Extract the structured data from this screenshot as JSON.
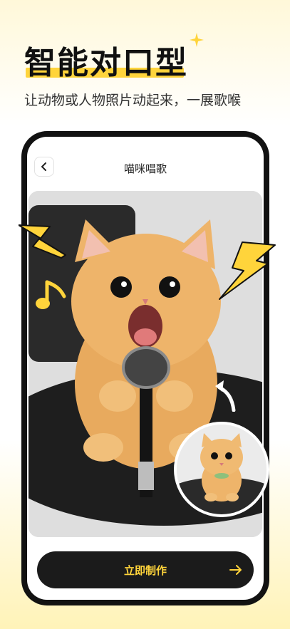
{
  "promo": {
    "headline": "智能对口型",
    "subtitle": "让动物或人物照片动起来，一展歌喉"
  },
  "app": {
    "nav_title": "喵咪唱歌",
    "back_icon": "chevron-left-icon",
    "cta_label": "立即制作",
    "cta_icon": "arrow-right-icon"
  },
  "colors": {
    "accent": "#ffd43b",
    "dark": "#121212"
  }
}
